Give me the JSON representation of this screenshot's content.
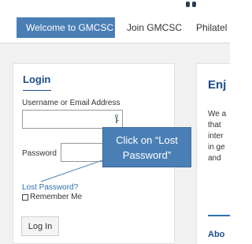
{
  "nav": {
    "items": [
      {
        "label": "Welcome to GMCSC",
        "active": true
      },
      {
        "label": "Join GMCSC",
        "active": false
      },
      {
        "label": "Philatel",
        "active": false
      }
    ]
  },
  "login": {
    "title": "Login",
    "username_label": "Username or Email Address",
    "username_value": "",
    "password_label": "Password",
    "password_value": "",
    "lost_password_link": "Lost Password?",
    "remember_label": "Remember Me",
    "submit_label": "Log In"
  },
  "callout": {
    "text": "Click on “Lost Password”"
  },
  "sidebar": {
    "title": "Enj",
    "lines": [
      "We a",
      "that",
      "inter",
      "in ge",
      "and"
    ],
    "about": "Abo"
  },
  "colors": {
    "accent": "#4a7fb5",
    "heading": "#1d4e89",
    "link": "#2e6fb0"
  }
}
